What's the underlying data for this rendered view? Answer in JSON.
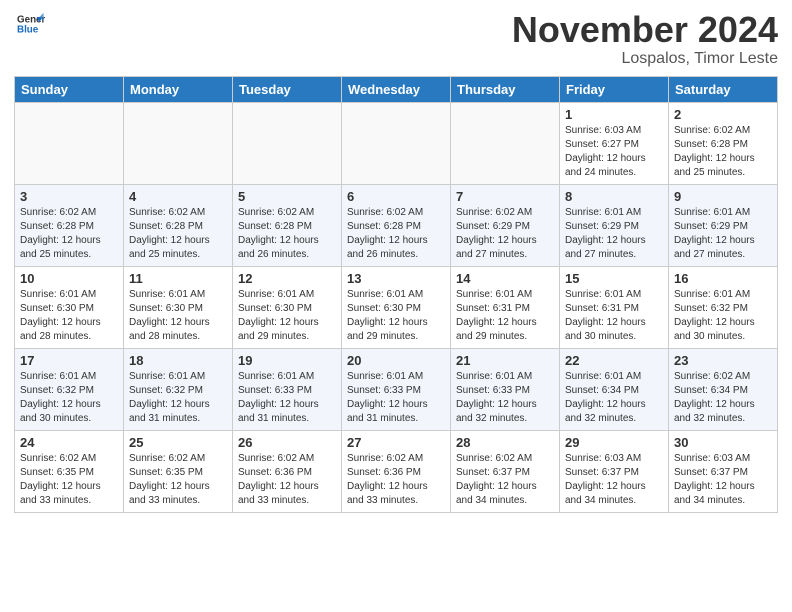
{
  "header": {
    "logo_general": "General",
    "logo_blue": "Blue",
    "month_title": "November 2024",
    "location": "Lospalos, Timor Leste"
  },
  "weekdays": [
    "Sunday",
    "Monday",
    "Tuesday",
    "Wednesday",
    "Thursday",
    "Friday",
    "Saturday"
  ],
  "weeks": [
    [
      {
        "day": "",
        "info": ""
      },
      {
        "day": "",
        "info": ""
      },
      {
        "day": "",
        "info": ""
      },
      {
        "day": "",
        "info": ""
      },
      {
        "day": "",
        "info": ""
      },
      {
        "day": "1",
        "info": "Sunrise: 6:03 AM\nSunset: 6:27 PM\nDaylight: 12 hours and 24 minutes."
      },
      {
        "day": "2",
        "info": "Sunrise: 6:02 AM\nSunset: 6:28 PM\nDaylight: 12 hours and 25 minutes."
      }
    ],
    [
      {
        "day": "3",
        "info": "Sunrise: 6:02 AM\nSunset: 6:28 PM\nDaylight: 12 hours and 25 minutes."
      },
      {
        "day": "4",
        "info": "Sunrise: 6:02 AM\nSunset: 6:28 PM\nDaylight: 12 hours and 25 minutes."
      },
      {
        "day": "5",
        "info": "Sunrise: 6:02 AM\nSunset: 6:28 PM\nDaylight: 12 hours and 26 minutes."
      },
      {
        "day": "6",
        "info": "Sunrise: 6:02 AM\nSunset: 6:28 PM\nDaylight: 12 hours and 26 minutes."
      },
      {
        "day": "7",
        "info": "Sunrise: 6:02 AM\nSunset: 6:29 PM\nDaylight: 12 hours and 27 minutes."
      },
      {
        "day": "8",
        "info": "Sunrise: 6:01 AM\nSunset: 6:29 PM\nDaylight: 12 hours and 27 minutes."
      },
      {
        "day": "9",
        "info": "Sunrise: 6:01 AM\nSunset: 6:29 PM\nDaylight: 12 hours and 27 minutes."
      }
    ],
    [
      {
        "day": "10",
        "info": "Sunrise: 6:01 AM\nSunset: 6:30 PM\nDaylight: 12 hours and 28 minutes."
      },
      {
        "day": "11",
        "info": "Sunrise: 6:01 AM\nSunset: 6:30 PM\nDaylight: 12 hours and 28 minutes."
      },
      {
        "day": "12",
        "info": "Sunrise: 6:01 AM\nSunset: 6:30 PM\nDaylight: 12 hours and 29 minutes."
      },
      {
        "day": "13",
        "info": "Sunrise: 6:01 AM\nSunset: 6:30 PM\nDaylight: 12 hours and 29 minutes."
      },
      {
        "day": "14",
        "info": "Sunrise: 6:01 AM\nSunset: 6:31 PM\nDaylight: 12 hours and 29 minutes."
      },
      {
        "day": "15",
        "info": "Sunrise: 6:01 AM\nSunset: 6:31 PM\nDaylight: 12 hours and 30 minutes."
      },
      {
        "day": "16",
        "info": "Sunrise: 6:01 AM\nSunset: 6:32 PM\nDaylight: 12 hours and 30 minutes."
      }
    ],
    [
      {
        "day": "17",
        "info": "Sunrise: 6:01 AM\nSunset: 6:32 PM\nDaylight: 12 hours and 30 minutes."
      },
      {
        "day": "18",
        "info": "Sunrise: 6:01 AM\nSunset: 6:32 PM\nDaylight: 12 hours and 31 minutes."
      },
      {
        "day": "19",
        "info": "Sunrise: 6:01 AM\nSunset: 6:33 PM\nDaylight: 12 hours and 31 minutes."
      },
      {
        "day": "20",
        "info": "Sunrise: 6:01 AM\nSunset: 6:33 PM\nDaylight: 12 hours and 31 minutes."
      },
      {
        "day": "21",
        "info": "Sunrise: 6:01 AM\nSunset: 6:33 PM\nDaylight: 12 hours and 32 minutes."
      },
      {
        "day": "22",
        "info": "Sunrise: 6:01 AM\nSunset: 6:34 PM\nDaylight: 12 hours and 32 minutes."
      },
      {
        "day": "23",
        "info": "Sunrise: 6:02 AM\nSunset: 6:34 PM\nDaylight: 12 hours and 32 minutes."
      }
    ],
    [
      {
        "day": "24",
        "info": "Sunrise: 6:02 AM\nSunset: 6:35 PM\nDaylight: 12 hours and 33 minutes."
      },
      {
        "day": "25",
        "info": "Sunrise: 6:02 AM\nSunset: 6:35 PM\nDaylight: 12 hours and 33 minutes."
      },
      {
        "day": "26",
        "info": "Sunrise: 6:02 AM\nSunset: 6:36 PM\nDaylight: 12 hours and 33 minutes."
      },
      {
        "day": "27",
        "info": "Sunrise: 6:02 AM\nSunset: 6:36 PM\nDaylight: 12 hours and 33 minutes."
      },
      {
        "day": "28",
        "info": "Sunrise: 6:02 AM\nSunset: 6:37 PM\nDaylight: 12 hours and 34 minutes."
      },
      {
        "day": "29",
        "info": "Sunrise: 6:03 AM\nSunset: 6:37 PM\nDaylight: 12 hours and 34 minutes."
      },
      {
        "day": "30",
        "info": "Sunrise: 6:03 AM\nSunset: 6:37 PM\nDaylight: 12 hours and 34 minutes."
      }
    ]
  ]
}
